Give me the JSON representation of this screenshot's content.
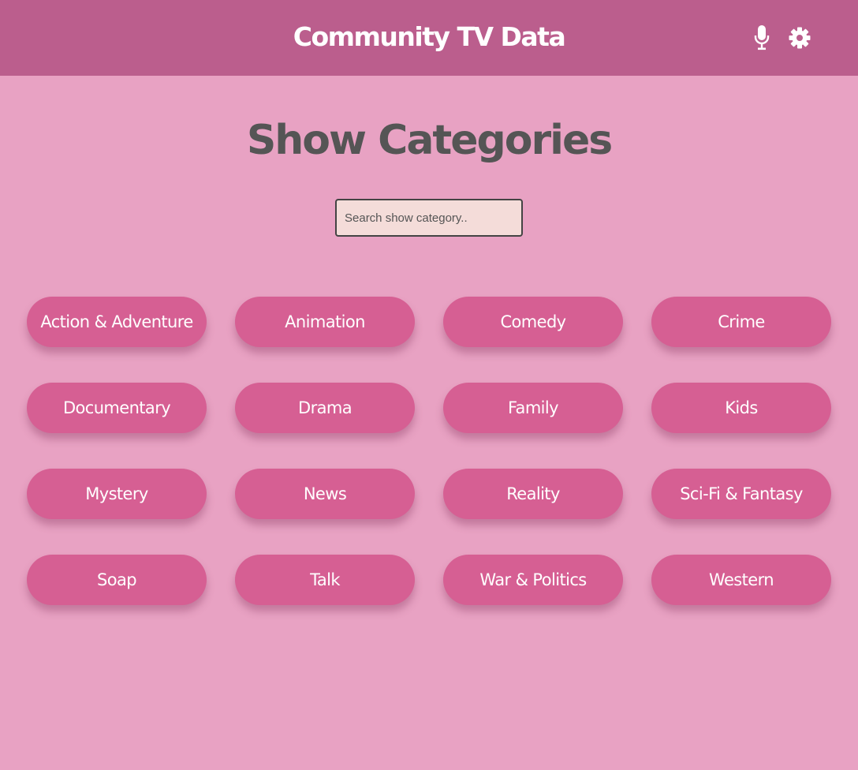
{
  "header": {
    "title": "Community TV Data",
    "mic_icon": "microphone-icon",
    "settings_icon": "gear-icon"
  },
  "main": {
    "heading": "Show Categories",
    "search": {
      "placeholder": "Search show category..",
      "value": ""
    },
    "categories": [
      "Action & Adventure",
      "Animation",
      "Comedy",
      "Crime",
      "Documentary",
      "Drama",
      "Family",
      "Kids",
      "Mystery",
      "News",
      "Reality",
      "Sci-Fi & Fantasy",
      "Soap",
      "Talk",
      "War & Politics",
      "Western"
    ]
  },
  "colors": {
    "header_bg": "#bb5e8d",
    "page_bg": "#e8a2c3",
    "button_bg": "#d65f93",
    "heading_text": "#555555",
    "search_bg": "#f4dcd9"
  }
}
